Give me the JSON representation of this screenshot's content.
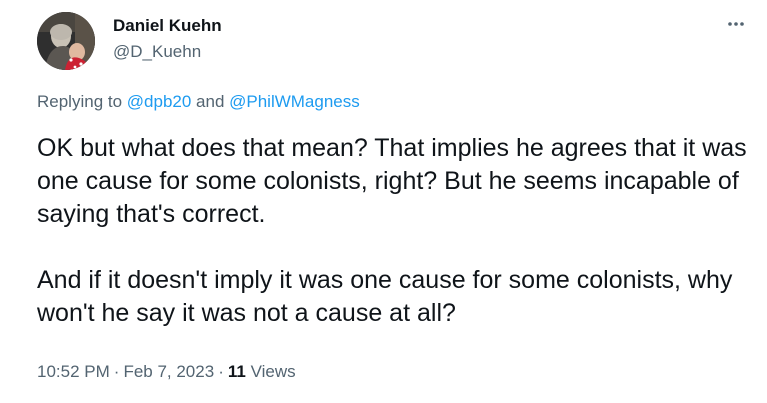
{
  "author": {
    "name": "Daniel Kuehn",
    "handle": "@D_Kuehn"
  },
  "reply": {
    "prefix": "Replying to ",
    "mention1": "@dpb20",
    "conjunction": " and ",
    "mention2": "@PhilWMagness"
  },
  "tweet": {
    "paragraph1": "OK but what does that mean? That implies he agrees that it was one cause for some colonists, right? But he seems incapable of saying that's correct.",
    "paragraph2": "And if it doesn't imply it was one cause for some colonists, why won't he say it was not a cause at all?"
  },
  "meta": {
    "time": "10:52 PM",
    "separator": "·",
    "date": "Feb 7, 2023",
    "views_count": "11",
    "views_label": " Views"
  },
  "icons": {
    "more": "more-horizontal-icon",
    "avatar": "profile-photo"
  },
  "colors": {
    "text": "#0f1419",
    "secondary": "#536471",
    "link": "#1d9bf0"
  }
}
